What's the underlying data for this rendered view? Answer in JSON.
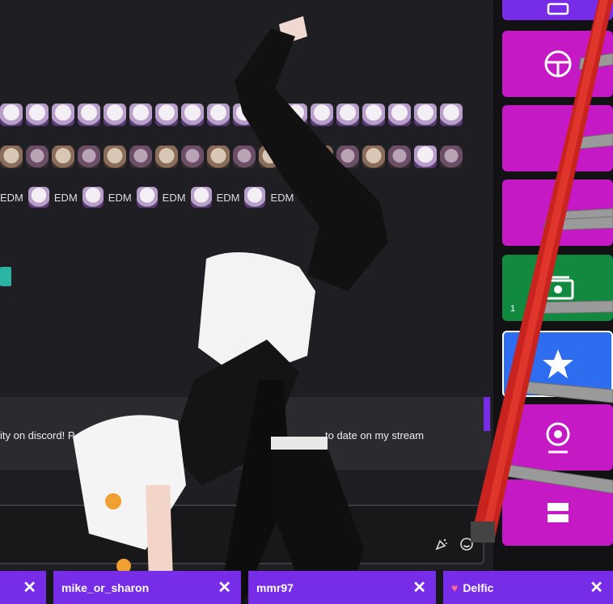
{
  "chat": {
    "edm_label": "EDM",
    "pinned_message_left": "ity on discord! P",
    "pinned_message_right": "to date on my stream"
  },
  "chips": [
    {
      "label": ""
    },
    {
      "label": "mike_or_sharon"
    },
    {
      "label": "mmr97"
    },
    {
      "label": "Delfic"
    }
  ],
  "sidebar": {
    "tiles": [
      {
        "icon": "card-icon",
        "color": "#772ce8"
      },
      {
        "icon": "steering-icon",
        "color": "#c419c4"
      },
      {
        "icon": "unknown-icon",
        "color": "#c419c4"
      },
      {
        "icon": "unknown-icon",
        "color": "#c419c4"
      },
      {
        "icon": "cash-icon",
        "color": "#118a3f",
        "label": "1"
      },
      {
        "icon": "star-icon",
        "color": "#2e6df0"
      },
      {
        "icon": "webcam-icon",
        "color": "#c419c4"
      },
      {
        "icon": "storage-icon",
        "color": "#c419c4"
      }
    ]
  }
}
